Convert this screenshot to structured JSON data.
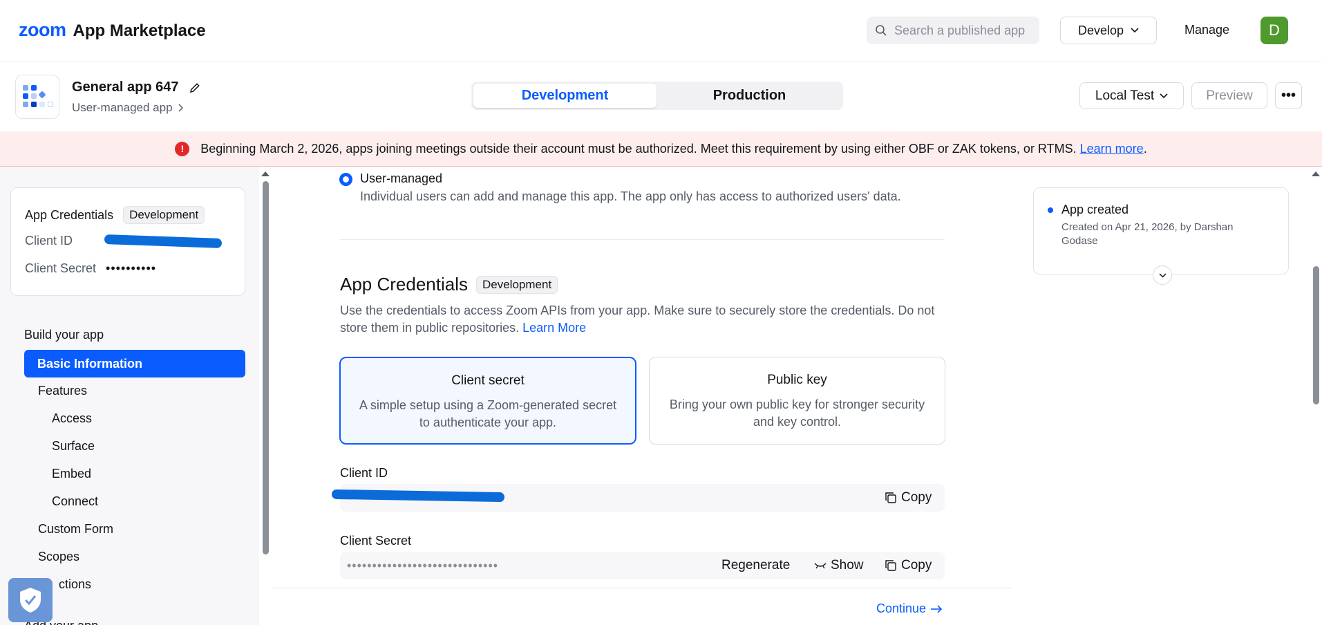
{
  "header": {
    "logo_brand": "zoom",
    "logo_product": "App Marketplace",
    "search_placeholder": "Search a published app",
    "develop_label": "Develop",
    "manage_label": "Manage",
    "avatar_initial": "D"
  },
  "app": {
    "name": "General app 647",
    "type": "User-managed app",
    "env_tabs": [
      "Development",
      "Production"
    ],
    "active_env": "Development",
    "local_test_label": "Local Test",
    "preview_label": "Preview",
    "more_label": "•••"
  },
  "banner": {
    "text": "Beginning March 2, 2026, apps joining meetings outside their account must be authorized. Meet this requirement by using either OBF or ZAK tokens, or RTMS.",
    "link": "Learn more",
    "trailing": "."
  },
  "sidebar": {
    "cred_title": "App Credentials",
    "cred_badge": "Development",
    "client_id_label": "Client ID",
    "client_secret_label": "Client Secret",
    "client_secret_masked": "••••••••••",
    "build_heading": "Build your app",
    "items": [
      {
        "label": "Basic Information"
      },
      {
        "label": "Features"
      },
      {
        "label": "Access"
      },
      {
        "label": "Surface"
      },
      {
        "label": "Embed"
      },
      {
        "label": "Connect"
      },
      {
        "label": "Custom Form"
      },
      {
        "label": "Scopes"
      },
      {
        "label": "ctions"
      },
      {
        "label": "Add your app"
      }
    ]
  },
  "main": {
    "management_option": "User-managed",
    "management_desc": "Individual users can add and manage this app. The app only has access to authorized users' data.",
    "section_title": "App Credentials",
    "section_badge": "Development",
    "section_desc": "Use the credentials to access Zoom APIs from your app. Make sure to securely store the credentials. Do not store them in public repositories.",
    "section_link": "Learn More",
    "options": [
      {
        "title": "Client secret",
        "desc": "A simple setup using a Zoom-generated secret to authenticate your app."
      },
      {
        "title": "Public key",
        "desc": "Bring your own public key for stronger security and key control."
      }
    ],
    "client_id_label": "Client ID",
    "client_secret_label": "Client Secret",
    "client_secret_masked": "••••••••••••••••••••••••••••••",
    "copy_label": "Copy",
    "regenerate_label": "Regenerate",
    "show_label": "Show",
    "continue_label": "Continue"
  },
  "timeline": {
    "title": "App created",
    "desc": "Created on Apr 21, 2026, by Darshan Godase"
  }
}
